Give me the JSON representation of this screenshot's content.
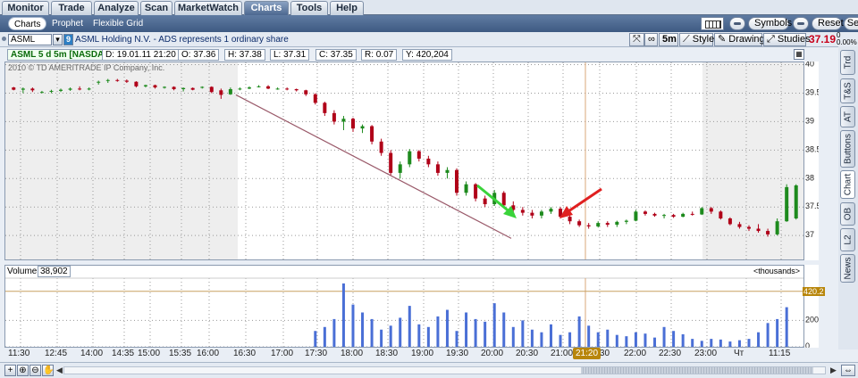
{
  "top_tabs": [
    "Monitor",
    "Trade",
    "Analyze",
    "Scan",
    "MarketWatch",
    "Charts",
    "Tools",
    "Help"
  ],
  "active_top_tab": "Charts",
  "sub_tabs": [
    "Charts",
    "Prophet",
    "Flexible Grid"
  ],
  "toolbar": {
    "symbols_label": "Symbols",
    "reset_label": "Reset",
    "set_label": "Set"
  },
  "symbol_row": {
    "symbol": "ASML",
    "link_number": "9",
    "description": "ASML Holding N.V. - ADS represents 1 ordinary share",
    "aggregation": "5m",
    "style_label": "Style",
    "drawings_label": "Drawings",
    "studies_label": "Studies",
    "last_price": "37.19",
    "net_change_top": "0",
    "net_change_pct": "0.00%"
  },
  "info_bar": {
    "symbol_label": "ASML 5 d 5m [NASDAQ]",
    "date": "D: 19.01.11 21:20",
    "open": "O: 37.36",
    "high": "H: 37.38",
    "low": "L: 37.31",
    "close": "C: 37.35",
    "range": "R: 0.07",
    "volume": "Y: 420,204"
  },
  "watermark": "2010 © TD AMERITRADE IP Company, Inc.",
  "volume_panel": {
    "label": "Volume",
    "value": "38,902",
    "units": "<thousands>",
    "current_marker": "420.2"
  },
  "side_tabs": [
    "Trd",
    "T&S",
    "AT",
    "Buttons",
    "Chart",
    "OB",
    "L2",
    "News"
  ],
  "active_side_tab": "Chart",
  "time_cursor": "21:20",
  "colors": {
    "up": "#1d8a1d",
    "down": "#b00018",
    "volume": "#4a6fd6",
    "trendline": "#9a5a6a",
    "green_arrow": "#3ad33a",
    "red_arrow": "#e02020",
    "cursor": "#d9a77a"
  },
  "chart_data": {
    "type": "candlestick",
    "y_ticks": [
      "40",
      "39.5",
      "39",
      "38.5",
      "38",
      "37.5",
      "37"
    ],
    "y_tick_values": [
      40,
      39.5,
      39,
      38.5,
      38,
      37.5,
      37
    ],
    "ylim": [
      36.58,
      40.04
    ],
    "vol_ticks": [
      "200",
      "0"
    ],
    "vol_tick_values": [
      200,
      0
    ],
    "vol_ylim": [
      0,
      520
    ],
    "x_labels": [
      "11:30",
      "12:45",
      "14:00",
      "14:35",
      "15:00",
      "15:35",
      "16:00",
      "16:30",
      "17:00",
      "17:30",
      "18:00",
      "18:30",
      "19:00",
      "19:30",
      "20:00",
      "20:30",
      "21:00",
      "21:30",
      "22:00",
      "22:30",
      "23:00",
      "Чт",
      "11:15"
    ],
    "candles": [
      [
        39.6,
        39.61,
        39.55,
        39.56
      ],
      [
        39.56,
        39.6,
        39.5,
        39.58
      ],
      [
        39.58,
        39.6,
        39.52,
        39.55
      ],
      [
        39.52,
        39.54,
        39.5,
        39.52
      ],
      [
        39.53,
        39.56,
        39.5,
        39.54
      ],
      [
        39.54,
        39.58,
        39.52,
        39.56
      ],
      [
        39.56,
        39.6,
        39.54,
        39.58
      ],
      [
        39.58,
        39.62,
        39.55,
        39.57
      ],
      [
        39.57,
        39.6,
        39.55,
        39.58
      ],
      [
        39.7,
        39.72,
        39.65,
        39.7
      ],
      [
        39.72,
        39.75,
        39.68,
        39.73
      ],
      [
        39.73,
        39.75,
        39.7,
        39.72
      ],
      [
        39.72,
        39.74,
        39.68,
        39.7
      ],
      [
        39.7,
        39.71,
        39.6,
        39.62
      ],
      [
        39.62,
        39.65,
        39.6,
        39.64
      ],
      [
        39.64,
        39.65,
        39.58,
        39.6
      ],
      [
        39.6,
        39.62,
        39.58,
        39.61
      ],
      [
        39.61,
        39.62,
        39.55,
        39.57
      ],
      [
        39.57,
        39.6,
        39.53,
        39.59
      ],
      [
        39.59,
        39.6,
        39.55,
        39.56
      ],
      [
        39.6,
        39.62,
        39.58,
        39.61
      ],
      [
        39.61,
        39.62,
        39.5,
        39.52
      ],
      [
        39.55,
        39.58,
        39.4,
        39.47
      ],
      [
        39.48,
        39.6,
        39.47,
        39.57
      ],
      [
        39.57,
        39.6,
        39.55,
        39.58
      ],
      [
        39.58,
        39.62,
        39.57,
        39.6
      ],
      [
        39.62,
        39.64,
        39.6,
        39.62
      ],
      [
        39.62,
        39.64,
        39.57,
        39.58
      ],
      [
        39.58,
        39.6,
        39.56,
        39.58
      ],
      [
        39.58,
        39.6,
        39.55,
        39.57
      ],
      [
        39.57,
        39.58,
        39.53,
        39.55
      ],
      [
        39.55,
        39.56,
        39.45,
        39.48
      ],
      [
        39.48,
        39.5,
        39.3,
        39.33
      ],
      [
        39.33,
        39.35,
        39.1,
        39.15
      ],
      [
        39.15,
        39.2,
        38.95,
        39.0
      ],
      [
        39.0,
        39.1,
        38.85,
        39.05
      ],
      [
        39.05,
        39.07,
        38.82,
        38.88
      ],
      [
        38.88,
        38.95,
        38.8,
        38.92
      ],
      [
        38.92,
        38.94,
        38.6,
        38.65
      ],
      [
        38.65,
        38.7,
        38.4,
        38.45
      ],
      [
        38.45,
        38.5,
        38.05,
        38.1
      ],
      [
        38.1,
        38.3,
        38.0,
        38.25
      ],
      [
        38.25,
        38.52,
        38.2,
        38.48
      ],
      [
        38.48,
        38.5,
        38.3,
        38.35
      ],
      [
        38.35,
        38.4,
        38.2,
        38.25
      ],
      [
        38.25,
        38.3,
        38.05,
        38.1
      ],
      [
        38.1,
        38.2,
        38.0,
        38.15
      ],
      [
        38.15,
        38.18,
        37.7,
        37.75
      ],
      [
        37.75,
        37.95,
        37.7,
        37.9
      ],
      [
        37.9,
        37.92,
        37.6,
        37.65
      ],
      [
        37.65,
        37.7,
        37.5,
        37.55
      ],
      [
        37.55,
        37.8,
        37.52,
        37.75
      ],
      [
        37.75,
        37.78,
        37.5,
        37.53
      ],
      [
        37.53,
        37.6,
        37.4,
        37.45
      ],
      [
        37.45,
        37.5,
        37.35,
        37.4
      ],
      [
        37.4,
        37.45,
        37.3,
        37.35
      ],
      [
        37.35,
        37.45,
        37.3,
        37.42
      ],
      [
        37.42,
        37.5,
        37.38,
        37.47
      ],
      [
        37.47,
        37.5,
        37.3,
        37.33
      ],
      [
        37.33,
        37.38,
        37.2,
        37.25
      ],
      [
        37.25,
        37.28,
        37.15,
        37.18
      ],
      [
        37.18,
        37.22,
        37.12,
        37.16
      ],
      [
        37.16,
        37.25,
        37.14,
        37.22
      ],
      [
        37.22,
        37.25,
        37.15,
        37.19
      ],
      [
        37.19,
        37.26,
        37.15,
        37.24
      ],
      [
        37.24,
        37.28,
        37.2,
        37.26
      ],
      [
        37.26,
        37.45,
        37.25,
        37.42
      ],
      [
        37.42,
        37.44,
        37.35,
        37.38
      ],
      [
        37.38,
        37.4,
        37.33,
        37.35
      ],
      [
        37.35,
        37.38,
        37.3,
        37.36
      ],
      [
        37.36,
        37.38,
        37.31,
        37.33
      ],
      [
        37.33,
        37.4,
        37.32,
        37.38
      ],
      [
        37.38,
        37.42,
        37.35,
        37.37
      ],
      [
        37.37,
        37.5,
        37.36,
        37.48
      ],
      [
        37.48,
        37.5,
        37.38,
        37.42
      ],
      [
        37.42,
        37.44,
        37.28,
        37.3
      ],
      [
        37.3,
        37.32,
        37.18,
        37.2
      ],
      [
        37.2,
        37.24,
        37.12,
        37.15
      ],
      [
        37.15,
        37.18,
        37.08,
        37.12
      ],
      [
        37.12,
        37.2,
        37.05,
        37.08
      ],
      [
        37.08,
        37.12,
        36.98,
        37.02
      ],
      [
        37.02,
        37.3,
        37.0,
        37.25
      ],
      [
        37.25,
        37.9,
        37.24,
        37.85
      ],
      [
        37.3,
        37.9,
        37.28,
        37.88
      ]
    ],
    "volumes": [
      0,
      0,
      0,
      0,
      0,
      0,
      0,
      0,
      0,
      0,
      0,
      0,
      0,
      0,
      0,
      0,
      0,
      0,
      0,
      0,
      0,
      0,
      0,
      0,
      0,
      0,
      0,
      0,
      0,
      0,
      0,
      0,
      120,
      150,
      210,
      480,
      320,
      260,
      210,
      130,
      160,
      220,
      310,
      170,
      150,
      230,
      280,
      120,
      260,
      210,
      190,
      330,
      260,
      150,
      200,
      130,
      110,
      170,
      90,
      110,
      230,
      160,
      110,
      130,
      90,
      80,
      110,
      100,
      70,
      150,
      120,
      95,
      60,
      45,
      60,
      55,
      40,
      50,
      60,
      110,
      180,
      210,
      300
    ],
    "trendline": {
      "start": [
        "16:30",
        39.47
      ],
      "end": [
        "20:00",
        36.95
      ]
    },
    "cursor_time": "21:20"
  }
}
